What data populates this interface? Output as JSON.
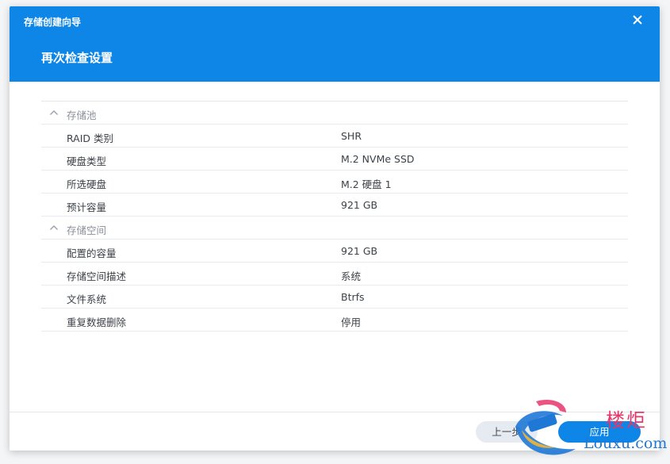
{
  "wizard": {
    "title": "存储创建向导",
    "page_title": "再次检查设置"
  },
  "groups": [
    {
      "label": "存储池",
      "rows": [
        {
          "label": "RAID 类别",
          "value": "SHR"
        },
        {
          "label": "硬盘类型",
          "value": "M.2 NVMe SSD"
        },
        {
          "label": "所选硬盘",
          "value": "M.2 硬盘 1"
        },
        {
          "label": "预计容量",
          "value": "921 GB"
        }
      ]
    },
    {
      "label": "存储空间",
      "rows": [
        {
          "label": "配置的容量",
          "value": "921 GB"
        },
        {
          "label": "存储空间描述",
          "value": "系统"
        },
        {
          "label": "文件系统",
          "value": "Btrfs"
        },
        {
          "label": "重复数据删除",
          "value": "停用"
        }
      ]
    }
  ],
  "footer": {
    "prev_label": "上一步",
    "apply_label": "应用"
  },
  "watermark": {
    "cn": "楼炬",
    "en": "Louxu.com"
  },
  "colors": {
    "accent": "#0e86e8",
    "watermark_red": "#e7356a",
    "watermark_blue": "#1f78d6"
  },
  "icons": {
    "close": "close-icon",
    "collapse": "chevron-up-icon"
  }
}
